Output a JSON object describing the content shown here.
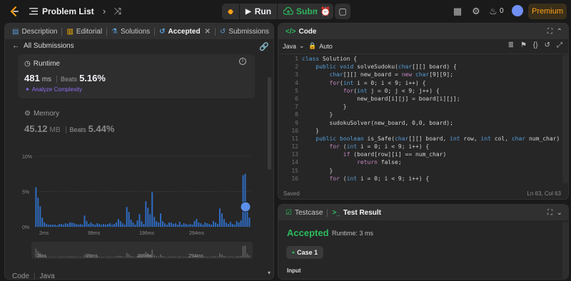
{
  "topbar": {
    "title": "Problem List",
    "run_label": "Run",
    "submit_label": "Submit",
    "streak_count": "0",
    "premium_label": "Premium"
  },
  "left_panel": {
    "tabs": [
      {
        "label": "Description",
        "icon": "description-icon"
      },
      {
        "label": "Editorial",
        "icon": "book-icon"
      },
      {
        "label": "Solutions",
        "icon": "flask-icon"
      },
      {
        "label": "Accepted",
        "icon": "history-icon"
      },
      {
        "label": "Submissions",
        "icon": "history-icon"
      }
    ],
    "back_label": "All Submissions",
    "runtime": {
      "label": "Runtime",
      "value": "481",
      "unit": "ms",
      "beats_label": "Beats",
      "beats_value": "5.16%",
      "analyze_label": "Analyze Complexity"
    },
    "memory": {
      "label": "Memory",
      "value": "45.12",
      "unit": "MB",
      "beats_label": "Beats",
      "beats_value": "5.44%"
    },
    "code_tab_label": "Code",
    "code_lang_label": "Java"
  },
  "chart_data": {
    "type": "bar",
    "ylim": [
      0,
      10
    ],
    "yticks": [
      "10%",
      "5%",
      "0%"
    ],
    "xticks": [
      "2ms",
      "99ms",
      "196ms",
      "294ms"
    ],
    "highlight_color": "#4a90e2",
    "bar_color": "#2f6dc4",
    "values": [
      5.6,
      4.1,
      2.9,
      1.3,
      0.6,
      0.4,
      0.3,
      0.3,
      0.3,
      0.3,
      0.2,
      0.4,
      0.4,
      0.3,
      0.5,
      0.4,
      0.6,
      0.6,
      0.5,
      0.4,
      0.3,
      0.4,
      0.3,
      1.6,
      0.8,
      0.4,
      0.6,
      0.4,
      0.3,
      0.5,
      0.4,
      0.3,
      0.4,
      0.3,
      0.4,
      0.5,
      0.3,
      0.4,
      0.6,
      1.1,
      0.8,
      0.5,
      0.3,
      2.8,
      2.1,
      1.0,
      0.6,
      0.3,
      0.9,
      1.8,
      0.8,
      0.4,
      3.6,
      2.7,
      1.8,
      4.9,
      1.4,
      0.8,
      0.6,
      1.9,
      0.8,
      0.5,
      0.3,
      0.6,
      0.6,
      0.4,
      0.5,
      0.3,
      0.7,
      0.3,
      0.5,
      0.4,
      0.3,
      0.4,
      0.3,
      0.8,
      1.1,
      0.6,
      0.5,
      0.3,
      0.6,
      0.5,
      0.4,
      0.3,
      0.8,
      0.6,
      0.4,
      2.6,
      1.9,
      1.1,
      0.6,
      0.4,
      0.7,
      0.4,
      0.3,
      0.8,
      0.6,
      0.9,
      7.3,
      7.5,
      2.4,
      1.3
    ]
  },
  "editor": {
    "title": "Code",
    "language": "Java",
    "mode": "Auto",
    "status_left": "Saved",
    "status_right": "Ln 63, Col 63",
    "lines": [
      "class Solution {",
      "    public void solveSudoku(char[][] board) {",
      "        char[][] new_board = new char[9][9];",
      "        for(int i = 0; i < 9; i++) {",
      "            for(int j = 0; j < 9; j++) {",
      "                new_board[i][j] = board[i][j];",
      "            }",
      "        }",
      "        sudokuSolver(new_board, 0,0, board);",
      "    }",
      "    public boolean is_Safe(char[][] board, int row, int col, char num_char) {",
      "        for (int i = 0; i < 9; i++) {",
      "            if (board[row][i] == num_char)",
      "                return false;",
      "        }",
      "        for (int i = 0; i < 9; i++) {"
    ]
  },
  "bottom_panel": {
    "tabs": [
      {
        "label": "Testcase",
        "icon": "checkbox-icon"
      },
      {
        "label": "Test Result",
        "icon": "terminal-icon"
      }
    ],
    "result": "Accepted",
    "runtime_text": "Runtime: 3 ms",
    "case_label": "Case 1",
    "input_label": "Input"
  },
  "colors": {
    "accent_green": "#2cbb5d",
    "accent_orange": "#ffa116",
    "accent_purple": "#8d6ff6"
  }
}
